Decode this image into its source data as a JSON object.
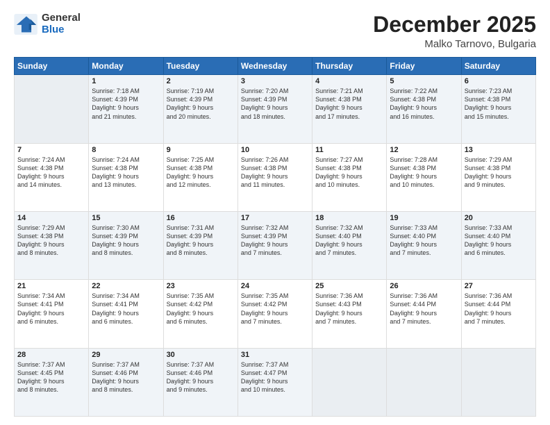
{
  "header": {
    "logo_general": "General",
    "logo_blue": "Blue",
    "month": "December 2025",
    "location": "Malko Tarnovo, Bulgaria"
  },
  "days_of_week": [
    "Sunday",
    "Monday",
    "Tuesday",
    "Wednesday",
    "Thursday",
    "Friday",
    "Saturday"
  ],
  "weeks": [
    [
      {
        "day": "",
        "info": ""
      },
      {
        "day": "1",
        "info": "Sunrise: 7:18 AM\nSunset: 4:39 PM\nDaylight: 9 hours\nand 21 minutes."
      },
      {
        "day": "2",
        "info": "Sunrise: 7:19 AM\nSunset: 4:39 PM\nDaylight: 9 hours\nand 20 minutes."
      },
      {
        "day": "3",
        "info": "Sunrise: 7:20 AM\nSunset: 4:39 PM\nDaylight: 9 hours\nand 18 minutes."
      },
      {
        "day": "4",
        "info": "Sunrise: 7:21 AM\nSunset: 4:38 PM\nDaylight: 9 hours\nand 17 minutes."
      },
      {
        "day": "5",
        "info": "Sunrise: 7:22 AM\nSunset: 4:38 PM\nDaylight: 9 hours\nand 16 minutes."
      },
      {
        "day": "6",
        "info": "Sunrise: 7:23 AM\nSunset: 4:38 PM\nDaylight: 9 hours\nand 15 minutes."
      }
    ],
    [
      {
        "day": "7",
        "info": "Sunrise: 7:24 AM\nSunset: 4:38 PM\nDaylight: 9 hours\nand 14 minutes."
      },
      {
        "day": "8",
        "info": "Sunrise: 7:24 AM\nSunset: 4:38 PM\nDaylight: 9 hours\nand 13 minutes."
      },
      {
        "day": "9",
        "info": "Sunrise: 7:25 AM\nSunset: 4:38 PM\nDaylight: 9 hours\nand 12 minutes."
      },
      {
        "day": "10",
        "info": "Sunrise: 7:26 AM\nSunset: 4:38 PM\nDaylight: 9 hours\nand 11 minutes."
      },
      {
        "day": "11",
        "info": "Sunrise: 7:27 AM\nSunset: 4:38 PM\nDaylight: 9 hours\nand 10 minutes."
      },
      {
        "day": "12",
        "info": "Sunrise: 7:28 AM\nSunset: 4:38 PM\nDaylight: 9 hours\nand 10 minutes."
      },
      {
        "day": "13",
        "info": "Sunrise: 7:29 AM\nSunset: 4:38 PM\nDaylight: 9 hours\nand 9 minutes."
      }
    ],
    [
      {
        "day": "14",
        "info": "Sunrise: 7:29 AM\nSunset: 4:38 PM\nDaylight: 9 hours\nand 8 minutes."
      },
      {
        "day": "15",
        "info": "Sunrise: 7:30 AM\nSunset: 4:39 PM\nDaylight: 9 hours\nand 8 minutes."
      },
      {
        "day": "16",
        "info": "Sunrise: 7:31 AM\nSunset: 4:39 PM\nDaylight: 9 hours\nand 8 minutes."
      },
      {
        "day": "17",
        "info": "Sunrise: 7:32 AM\nSunset: 4:39 PM\nDaylight: 9 hours\nand 7 minutes."
      },
      {
        "day": "18",
        "info": "Sunrise: 7:32 AM\nSunset: 4:40 PM\nDaylight: 9 hours\nand 7 minutes."
      },
      {
        "day": "19",
        "info": "Sunrise: 7:33 AM\nSunset: 4:40 PM\nDaylight: 9 hours\nand 7 minutes."
      },
      {
        "day": "20",
        "info": "Sunrise: 7:33 AM\nSunset: 4:40 PM\nDaylight: 9 hours\nand 6 minutes."
      }
    ],
    [
      {
        "day": "21",
        "info": "Sunrise: 7:34 AM\nSunset: 4:41 PM\nDaylight: 9 hours\nand 6 minutes."
      },
      {
        "day": "22",
        "info": "Sunrise: 7:34 AM\nSunset: 4:41 PM\nDaylight: 9 hours\nand 6 minutes."
      },
      {
        "day": "23",
        "info": "Sunrise: 7:35 AM\nSunset: 4:42 PM\nDaylight: 9 hours\nand 6 minutes."
      },
      {
        "day": "24",
        "info": "Sunrise: 7:35 AM\nSunset: 4:42 PM\nDaylight: 9 hours\nand 7 minutes."
      },
      {
        "day": "25",
        "info": "Sunrise: 7:36 AM\nSunset: 4:43 PM\nDaylight: 9 hours\nand 7 minutes."
      },
      {
        "day": "26",
        "info": "Sunrise: 7:36 AM\nSunset: 4:44 PM\nDaylight: 9 hours\nand 7 minutes."
      },
      {
        "day": "27",
        "info": "Sunrise: 7:36 AM\nSunset: 4:44 PM\nDaylight: 9 hours\nand 7 minutes."
      }
    ],
    [
      {
        "day": "28",
        "info": "Sunrise: 7:37 AM\nSunset: 4:45 PM\nDaylight: 9 hours\nand 8 minutes."
      },
      {
        "day": "29",
        "info": "Sunrise: 7:37 AM\nSunset: 4:46 PM\nDaylight: 9 hours\nand 8 minutes."
      },
      {
        "day": "30",
        "info": "Sunrise: 7:37 AM\nSunset: 4:46 PM\nDaylight: 9 hours\nand 9 minutes."
      },
      {
        "day": "31",
        "info": "Sunrise: 7:37 AM\nSunset: 4:47 PM\nDaylight: 9 hours\nand 10 minutes."
      },
      {
        "day": "",
        "info": ""
      },
      {
        "day": "",
        "info": ""
      },
      {
        "day": "",
        "info": ""
      }
    ]
  ]
}
